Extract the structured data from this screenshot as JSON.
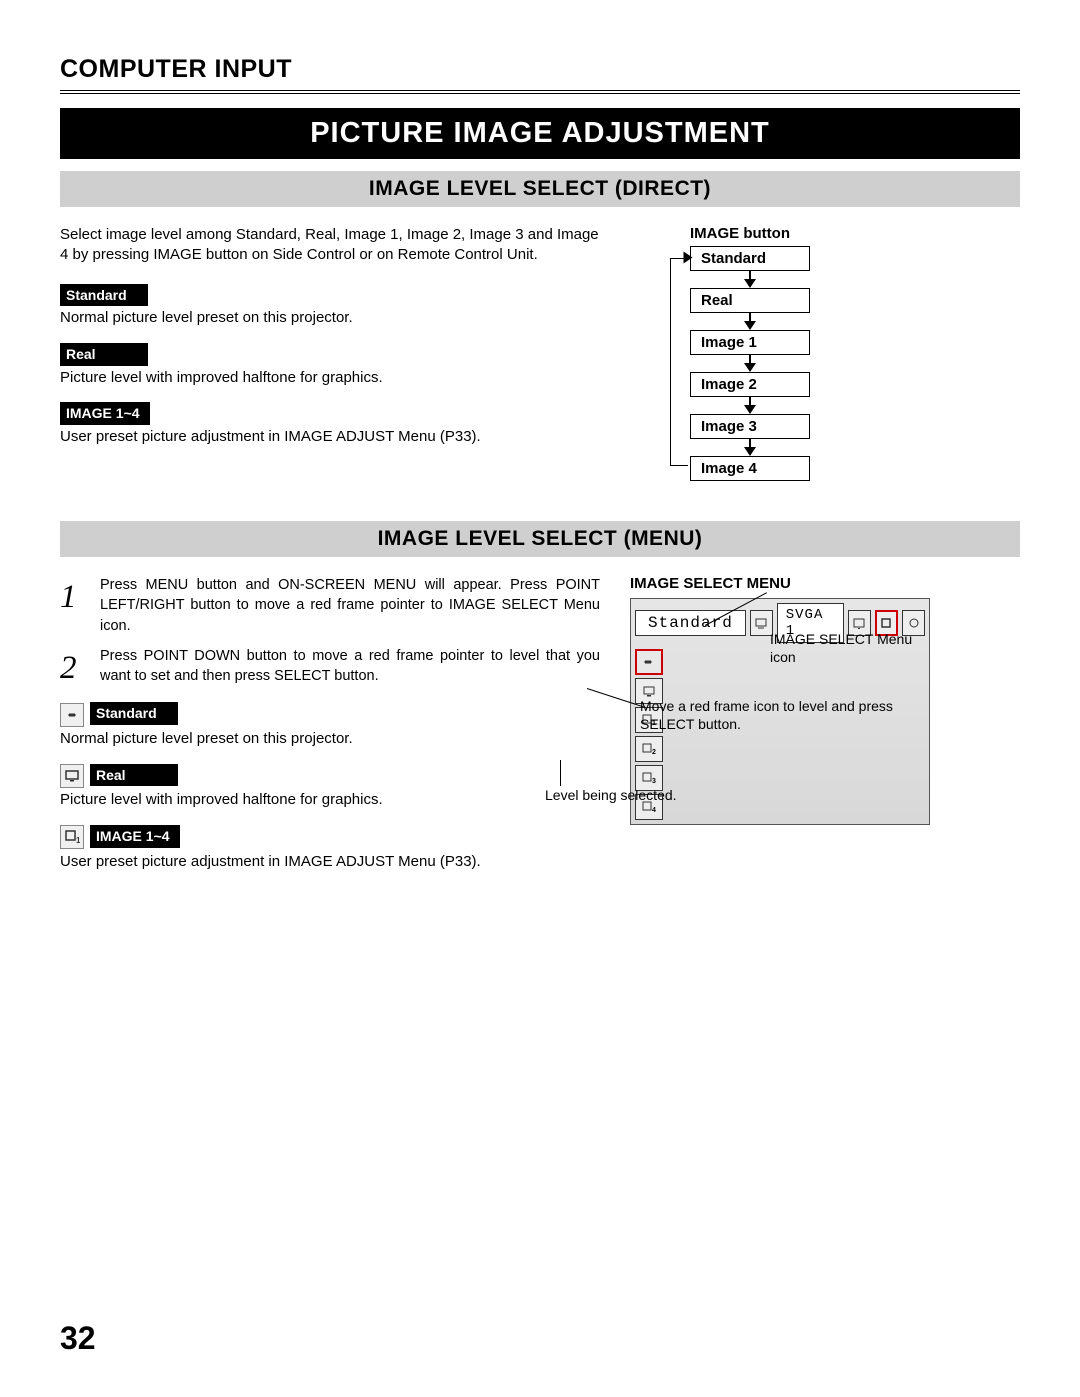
{
  "chapter": "COMPUTER INPUT",
  "banner": "PICTURE IMAGE ADJUSTMENT",
  "section1": {
    "title": "IMAGE LEVEL SELECT (DIRECT)",
    "intro": "Select image level among Standard, Real, Image 1, Image 2, Image 3 and Image 4 by pressing IMAGE button on Side Control or on Remote Control Unit.",
    "items": [
      {
        "tag": "Standard",
        "desc": "Normal picture level preset on this projector."
      },
      {
        "tag": "Real",
        "desc": "Picture level with improved halftone for graphics."
      },
      {
        "tag": "IMAGE 1~4",
        "desc": "User preset picture adjustment in IMAGE ADJUST Menu (P33)."
      }
    ],
    "flow": {
      "title": "IMAGE button",
      "states": [
        "Standard",
        "Real",
        "Image 1",
        "Image 2",
        "Image 3",
        "Image 4"
      ]
    }
  },
  "section2": {
    "title": "IMAGE LEVEL SELECT (MENU)",
    "steps": [
      {
        "num": "1",
        "text": "Press MENU button and ON-SCREEN MENU will appear.  Press POINT LEFT/RIGHT button to move a red frame pointer to IMAGE SELECT Menu icon."
      },
      {
        "num": "2",
        "text": "Press POINT DOWN button to move a red frame pointer to level that you want to set and then press SELECT button."
      }
    ],
    "items": [
      {
        "tag": "Standard",
        "desc": "Normal picture level preset on this projector."
      },
      {
        "tag": "Real",
        "desc": "Picture level with improved halftone for graphics."
      },
      {
        "tag": "IMAGE 1~4",
        "desc": "User preset picture adjustment in IMAGE ADJUST Menu (P33)."
      }
    ],
    "menu": {
      "title": "IMAGE SELECT MENU",
      "label": "Standard",
      "mode": "SVGA 1",
      "side_labels": [
        "",
        "",
        "1",
        "2",
        "3",
        "4"
      ],
      "callout1": "IMAGE SELECT Menu icon",
      "callout2": "Move a red frame icon to level and press SELECT button.",
      "callout3": "Level being selected."
    }
  },
  "page_number": "32"
}
